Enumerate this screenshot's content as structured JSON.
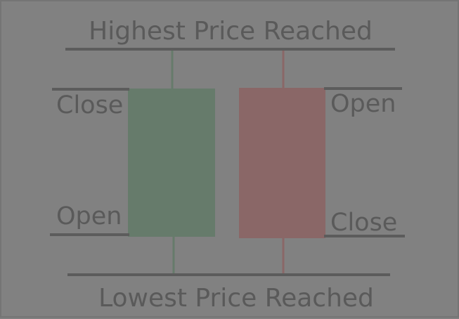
{
  "labels": {
    "high": "Highest Price Reached",
    "low": "Lowest Price Reached",
    "bull_close": "Close",
    "bull_open": "Open",
    "bear_open": "Open",
    "bear_close": "Close"
  },
  "colors": {
    "background": "#818181",
    "line": "#5c5c5c",
    "text": "#5a5a5a",
    "bullish": "#667b6b",
    "bearish": "#8a6767"
  }
}
